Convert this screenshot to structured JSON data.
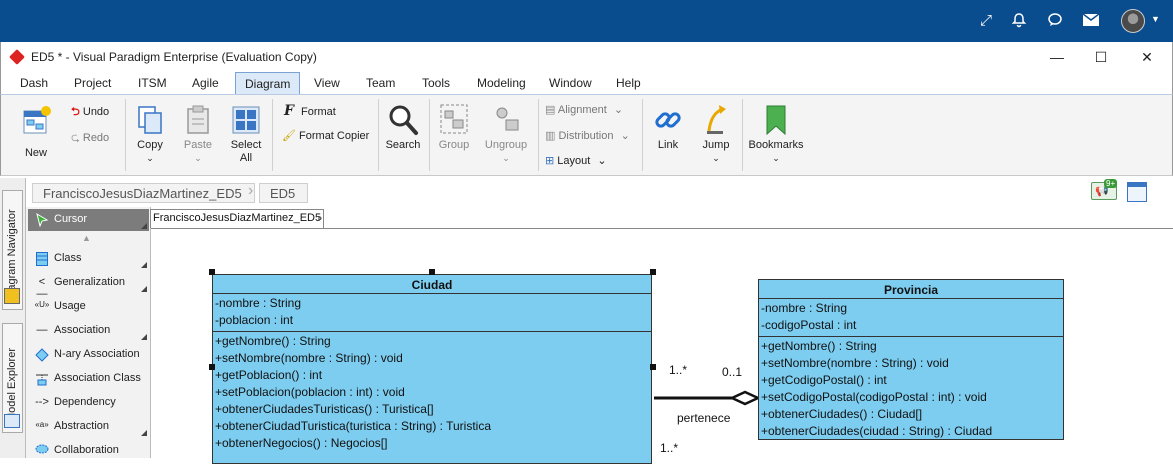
{
  "window": {
    "title": "ED5 * - Visual Paradigm Enterprise (Evaluation Copy)"
  },
  "menu": [
    "Dash",
    "Project",
    "ITSM",
    "Agile",
    "Diagram",
    "View",
    "Team",
    "Tools",
    "Modeling",
    "Window",
    "Help"
  ],
  "menu_active": "Diagram",
  "ribbon": {
    "new": "New",
    "undo": "Undo",
    "redo": "Redo",
    "copy": "Copy",
    "paste": "Paste",
    "select_all_1": "Select",
    "select_all_2": "All",
    "format": "Format",
    "format_copier": "Format Copier",
    "search": "Search",
    "group": "Group",
    "ungroup": "Ungroup",
    "alignment": "Alignment",
    "distribution": "Distribution",
    "layout": "Layout",
    "link": "Link",
    "jump": "Jump",
    "bookmarks": "Bookmarks"
  },
  "notification_badge": "9+",
  "breadcrumb": [
    "FranciscoJesusDiazMartinez_ED5",
    "ED5"
  ],
  "side_tabs": [
    "Diagram Navigator",
    "Model Explorer"
  ],
  "palette": [
    {
      "label": "Cursor",
      "icon": "cursor-icon",
      "selected": true
    },
    {
      "label": "Class",
      "icon": "class-icon"
    },
    {
      "label": "Generalization",
      "icon": "generalization-icon"
    },
    {
      "label": "Usage",
      "icon": "usage-icon"
    },
    {
      "label": "Association",
      "icon": "association-icon"
    },
    {
      "label": "N-ary Association",
      "icon": "nary-association-icon"
    },
    {
      "label": "Association Class",
      "icon": "association-class-icon"
    },
    {
      "label": "Dependency",
      "icon": "dependency-icon"
    },
    {
      "label": "Abstraction",
      "icon": "abstraction-icon"
    },
    {
      "label": "Collaboration",
      "icon": "collaboration-icon"
    }
  ],
  "palette_glyphs": {
    "usage": "«U»",
    "abstraction": "«a»"
  },
  "diagram_tab": "FranciscoJesusDiazMartinez_ED5",
  "diagram": {
    "ciudad": {
      "name": "Ciudad",
      "attributes": [
        "-nombre : String",
        "-poblacion : int"
      ],
      "operations": [
        "+getNombre() : String",
        "+setNombre(nombre : String) : void",
        "+getPoblacion() : int",
        "+setPoblacion(poblacion : int) : void",
        "+obtenerCiudadesTuristicas() : Turistica[]",
        "+obtenerCiudadTuristica(turistica : String) : Turistica",
        "+obtenerNegocios() : Negocios[]"
      ]
    },
    "provincia": {
      "name": "Provincia",
      "attributes": [
        "-nombre : String",
        "-codigoPostal : int"
      ],
      "operations": [
        "+getNombre() : String",
        "+setNombre(nombre : String) : void",
        "+getCodigoPostal() : int",
        "+setCodigoPostal(codigoPostal : int) : void",
        "+obtenerCiudades() : Ciudad[]",
        "+obtenerCiudades(ciudad : String) : Ciudad"
      ]
    },
    "association": {
      "label": "pertenece",
      "mult_ciudad": "1..*",
      "mult_provincia": "0..1",
      "mult_lower": "1..*"
    }
  },
  "colors": {
    "header": "#0a4d8e",
    "class_fill": "#7dcdf0",
    "ribbon_active": "#dce9f8"
  }
}
